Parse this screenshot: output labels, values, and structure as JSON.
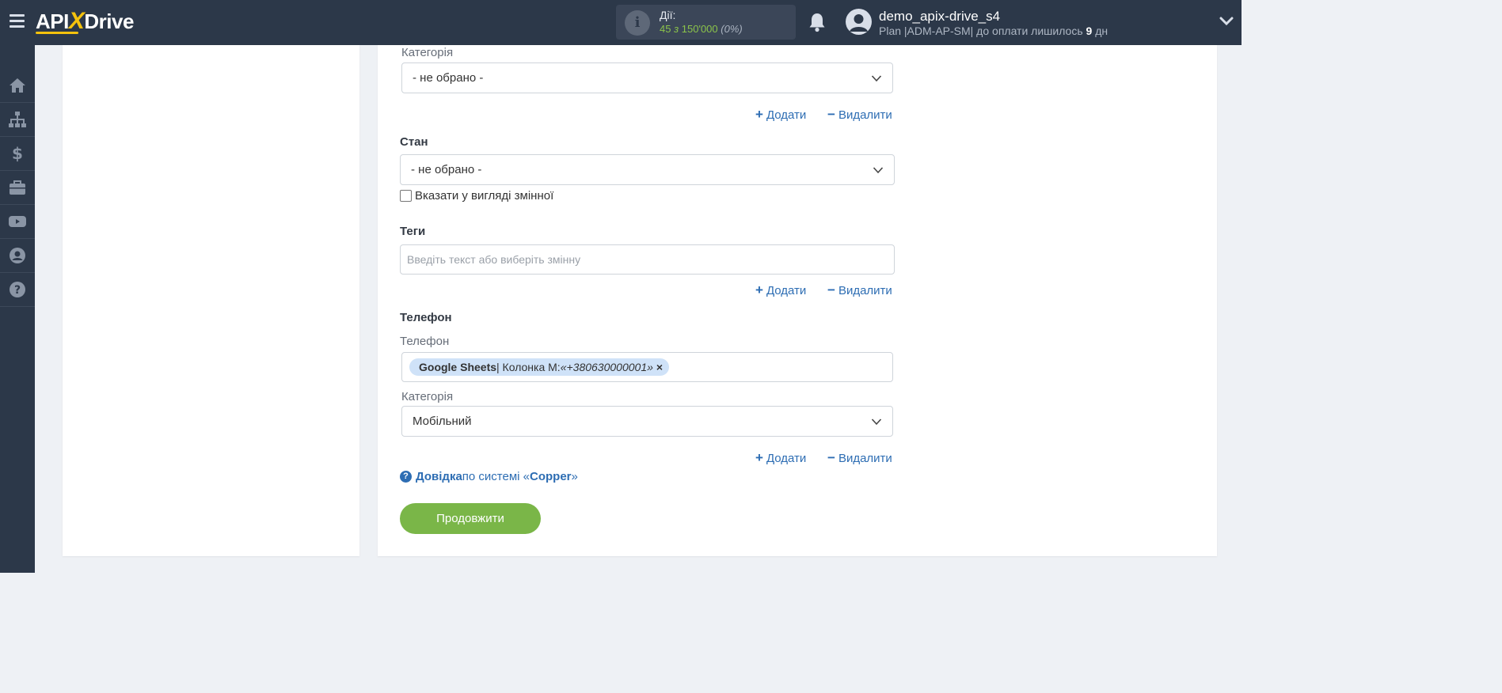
{
  "brand": {
    "logo_api": "API",
    "logo_x": "X",
    "logo_drive": "Drive"
  },
  "actions": {
    "label": "Дії:",
    "used": "45",
    "of_word": "з",
    "limit": "150'000",
    "percent": "(0%)"
  },
  "user": {
    "name": "demo_apix-drive_s4",
    "plan_prefix": "Plan |ADM-AP-SM| до оплати лишилось",
    "plan_days": "9",
    "plan_days_unit": "дн"
  },
  "sidebar": {
    "items": [
      "home-icon",
      "sitemap-icon",
      "dollar-icon",
      "briefcase-icon",
      "youtube-icon",
      "user-icon",
      "help-icon"
    ]
  },
  "form": {
    "category_top": {
      "label": "Категорія",
      "value": "- не обрано -"
    },
    "add_label": "Додати",
    "remove_label": "Видалити",
    "add_symbol": "+",
    "remove_symbol": "−",
    "status": {
      "label": "Стан",
      "value": "- не обрано -",
      "checkbox_label": "Вказати у вигляді змінної"
    },
    "tags": {
      "label": "Теги",
      "placeholder": "Введіть текст або виберіть змінну"
    },
    "phone": {
      "section_label": "Телефон",
      "field_label": "Телефон",
      "chip_source": "Google Sheets",
      "chip_sep": " | Колонка M: ",
      "chip_value": "«+380630000001»",
      "chip_close": "×",
      "category_label": "Категорія",
      "category_value": "Мобільний"
    },
    "help": {
      "link": "Довідка",
      "middle": " по системі «",
      "system": "Copper",
      "end": "»"
    },
    "continue_label": "Продовжити"
  }
}
